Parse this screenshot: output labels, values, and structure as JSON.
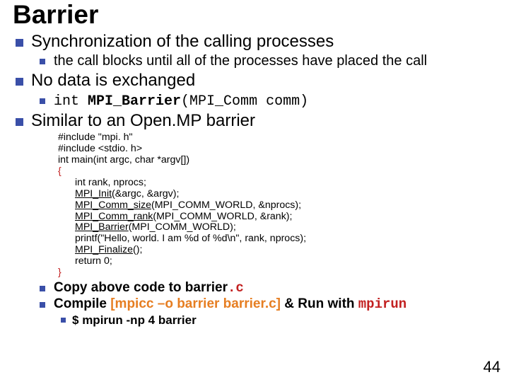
{
  "title": "Barrier",
  "b1": {
    "heading": "Synchronization of the calling processes",
    "sub": "the call blocks until all of the processes have placed the call"
  },
  "b2": {
    "heading": "No data is exchanged",
    "sig_prefix": "int ",
    "sig_name": "MPI_Barrier",
    "sig_args": "(MPI_Comm comm)"
  },
  "b3": {
    "heading": "Similar to an Open.MP barrier"
  },
  "code": {
    "l1": "#include \"mpi. h\"",
    "l2": "#include <stdio. h>",
    "l3": "int main(int argc, char *argv[])",
    "l4": "{",
    "l5a": "int rank, nprocs;",
    "l5b_name": "MPI_Init",
    "l5b_args": "(&argc, &argv);",
    "l5c_name": "MPI_Comm_size",
    "l5c_args": "(MPI_COMM_WORLD, &nprocs);",
    "l5d_name": "MPI_Comm_rank",
    "l5d_args": "(MPI_COMM_WORLD, &rank);",
    "l5e_name": "MPI_Barrier",
    "l5e_args": "(MPI_COMM_WORLD);",
    "l5f": "printf(\"Hello, world.  I am %d of %d\\n\", rank, nprocs);",
    "l5g_name": "MPI_Finalize",
    "l5g_args": "();",
    "l5h": "return 0;",
    "l6": "}"
  },
  "b4": {
    "prefix": "Copy above code to barrier",
    "ext": ".c"
  },
  "b5": {
    "prefix": "Compile ",
    "cmd": "[mpicc –o barrier barrier.c]",
    "mid": " & Run with ",
    "run": "mpirun",
    "sub_prefix": "$ ",
    "sub_cmd": "mpirun -np 4 barrier"
  },
  "page": "44"
}
